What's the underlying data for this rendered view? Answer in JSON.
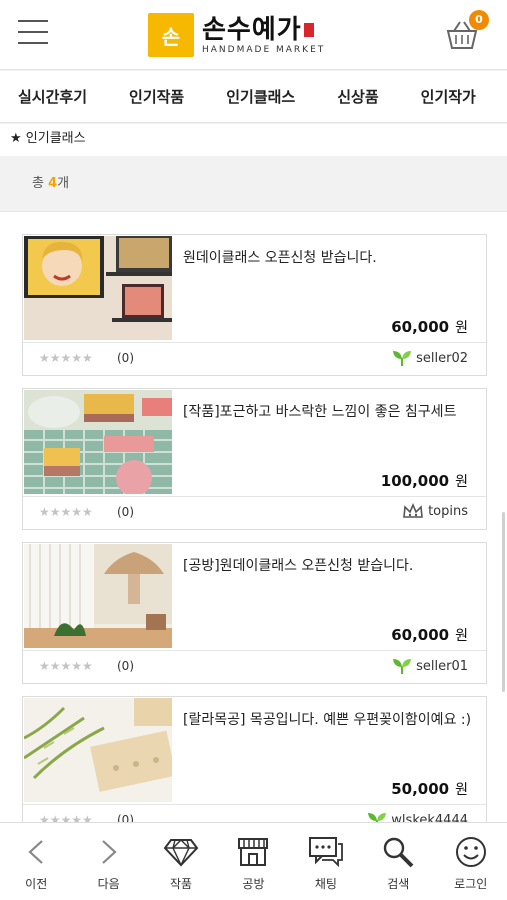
{
  "header": {
    "logo_mark": "손",
    "logo_title": "손수예가",
    "logo_subtitle": "HANDMADE MARKET",
    "cart_count": "0"
  },
  "tabs": [
    "실시간후기",
    "인기작품",
    "인기클래스",
    "신상품",
    "인기작가"
  ],
  "breadcrumb": "★ 인기클래스",
  "count": {
    "prefix": "총 ",
    "num": "4",
    "suffix": "개"
  },
  "products": [
    {
      "title": "원데이클래스 오픈신청 받습니다.",
      "price": "60,000",
      "won": "원",
      "stars": "★★★★★",
      "rating": "(0)",
      "seller": "seller02",
      "seller_icon": "sprout-icon"
    },
    {
      "title": "[작품]포근하고 바스락한 느낌이 좋은 침구세트",
      "price": "100,000",
      "won": "원",
      "stars": "★★★★★",
      "rating": "(0)",
      "seller": "topins",
      "seller_icon": "crown-icon"
    },
    {
      "title": "[공방]원데이클래스 오픈신청 받습니다.",
      "price": "60,000",
      "won": "원",
      "stars": "★★★★★",
      "rating": "(0)",
      "seller": "seller01",
      "seller_icon": "sprout-icon"
    },
    {
      "title": "[랄라목공] 목공입니다. 예쁜 우편꽂이함이예요 :)",
      "price": "50,000",
      "won": "원",
      "stars": "★★★★★",
      "rating": "(0)",
      "seller": "wlskek4444",
      "seller_icon": "sprout-icon"
    }
  ],
  "bottom_nav": [
    {
      "label": "이전",
      "icon": "back-icon"
    },
    {
      "label": "다음",
      "icon": "forward-icon"
    },
    {
      "label": "작품",
      "icon": "diamond-icon"
    },
    {
      "label": "공방",
      "icon": "shop-icon"
    },
    {
      "label": "채팅",
      "icon": "chat-icon"
    },
    {
      "label": "검색",
      "icon": "search-icon"
    },
    {
      "label": "로그인",
      "icon": "smile-icon"
    }
  ],
  "colors": {
    "accent": "#f6b800",
    "badge": "#f08a00",
    "sprout": "#5cb82e"
  }
}
